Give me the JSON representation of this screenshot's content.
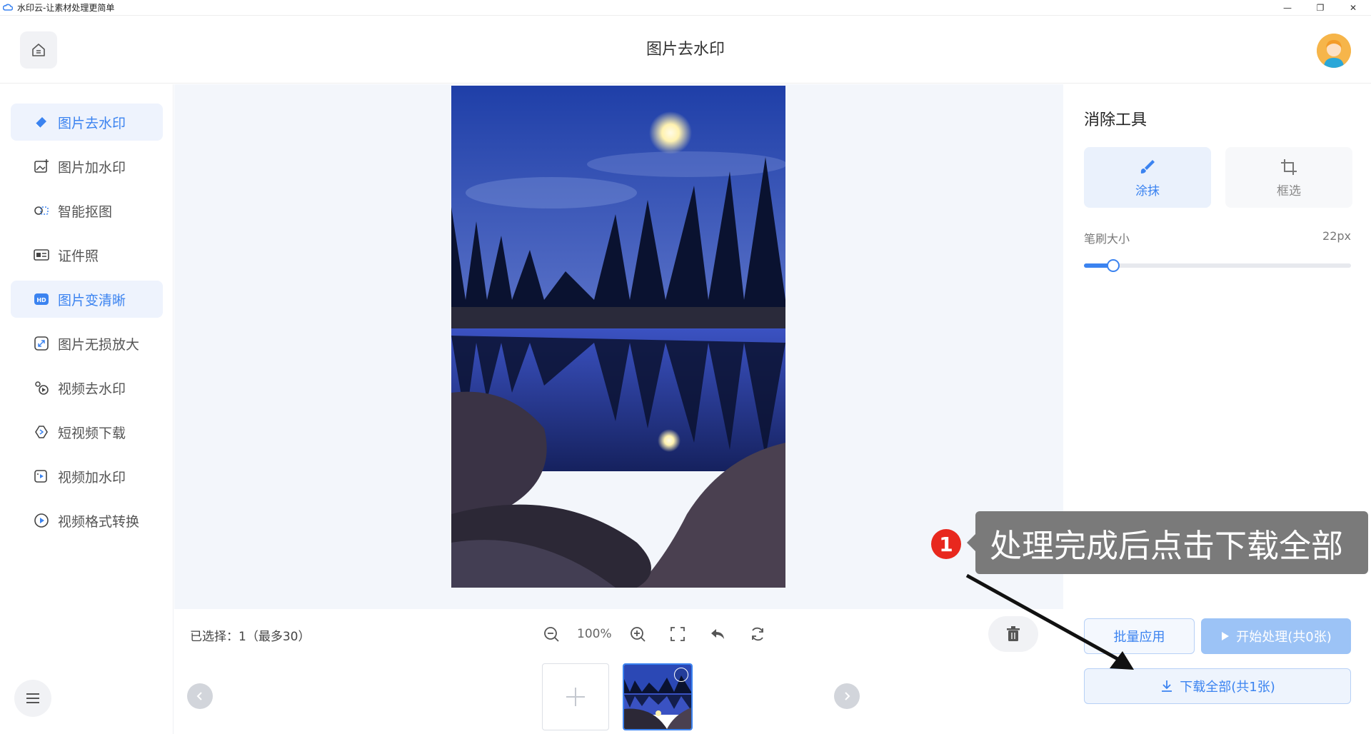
{
  "titlebar": {
    "title": "水印云-让素材处理更简单",
    "minimize": "—",
    "restore": "❐",
    "close": "✕"
  },
  "header": {
    "title": "图片去水印"
  },
  "sidebar": {
    "items": [
      {
        "label": "图片去水印",
        "icon": "eraser-icon",
        "active": true
      },
      {
        "label": "图片加水印",
        "icon": "image-add-icon",
        "active": false
      },
      {
        "label": "智能抠图",
        "icon": "cutout-icon",
        "active": false
      },
      {
        "label": "证件照",
        "icon": "id-card-icon",
        "active": false
      },
      {
        "label": "图片变清晰",
        "icon": "hd-icon",
        "active": true
      },
      {
        "label": "图片无损放大",
        "icon": "expand-icon",
        "active": false
      },
      {
        "label": "视频去水印",
        "icon": "video-eraser-icon",
        "active": false
      },
      {
        "label": "短视频下载",
        "icon": "link-icon",
        "active": false
      },
      {
        "label": "视频加水印",
        "icon": "video-add-icon",
        "active": false
      },
      {
        "label": "视频格式转换",
        "icon": "play-circle-icon",
        "active": false
      }
    ]
  },
  "canvas": {
    "selected_text": "已选择：1（最多30）",
    "zoom": "100%"
  },
  "right_panel": {
    "title": "消除工具",
    "tools": [
      {
        "label": "涂抹",
        "icon": "brush-icon",
        "active": true
      },
      {
        "label": "框选",
        "icon": "crop-icon",
        "active": false
      }
    ],
    "brush_label": "笔刷大小",
    "brush_value": "22px",
    "brush_level": 0.11,
    "batch_button": "批量应用",
    "start_button": "开始处理(共0张)",
    "download_button": "下载全部(共1张)"
  },
  "annotation": {
    "step": "1",
    "text": "处理完成后点击下载全部"
  },
  "colors": {
    "accent": "#3b83f0",
    "callout": "#7a7a7a",
    "badge": "#e8281e"
  }
}
